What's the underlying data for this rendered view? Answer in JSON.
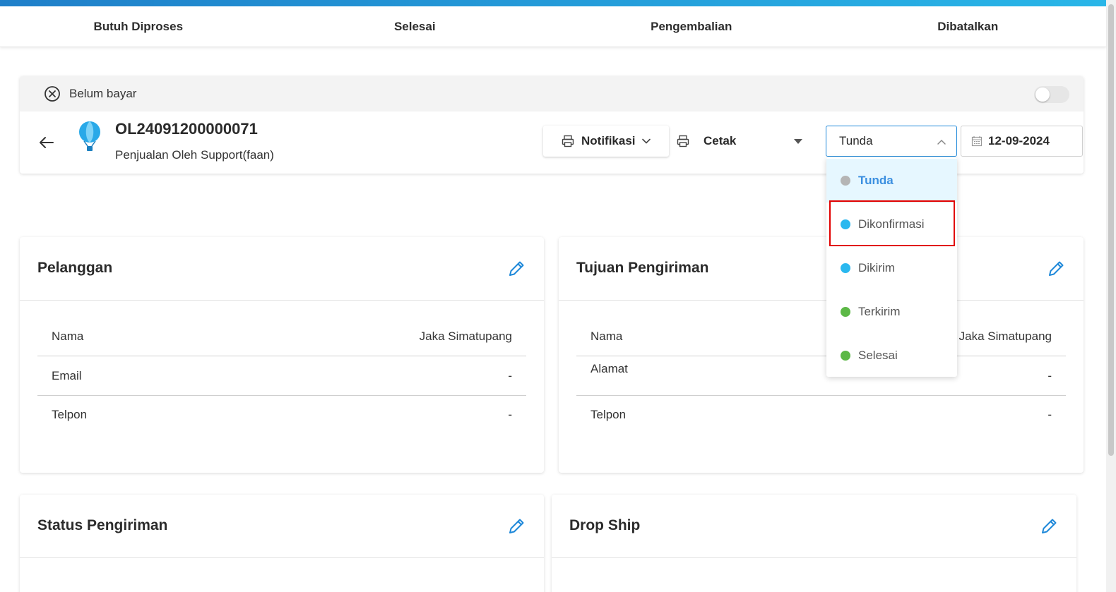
{
  "tabs": [
    "Butuh Diproses",
    "Selesai",
    "Pengembalian",
    "Dibatalkan"
  ],
  "order": {
    "payment_status": "Belum bayar",
    "id": "OL24091200000071",
    "subtitle": "Penjualan Oleh Support(faan)",
    "notif_label": "Notifikasi",
    "print_label": "Cetak",
    "status_value": "Tunda",
    "date_value": "12-09-2024"
  },
  "status_options": [
    {
      "label": "Tunda",
      "color": "#b5b5b5"
    },
    {
      "label": "Dikonfirmasi",
      "color": "#2ab8ef"
    },
    {
      "label": "Dikirim",
      "color": "#2ab8ef"
    },
    {
      "label": "Terkirim",
      "color": "#5cb846"
    },
    {
      "label": "Selesai",
      "color": "#5cb846"
    }
  ],
  "customer": {
    "title": "Pelanggan",
    "rows": [
      {
        "key": "Nama",
        "value": "Jaka Simatupang"
      },
      {
        "key": "Email",
        "value": "-"
      },
      {
        "key": "Telpon",
        "value": "-"
      }
    ]
  },
  "shipping": {
    "title": "Tujuan Pengiriman",
    "rows": [
      {
        "key": "Nama",
        "value": "Jaka Simatupang"
      },
      {
        "key": "Alamat",
        "value": "-"
      },
      {
        "key": "Telpon",
        "value": "-"
      }
    ]
  },
  "shipping_status": {
    "title": "Status Pengiriman"
  },
  "drop_ship": {
    "title": "Drop Ship"
  },
  "colors": {
    "accent": "#1e88d9",
    "highlight": "#e10000"
  }
}
